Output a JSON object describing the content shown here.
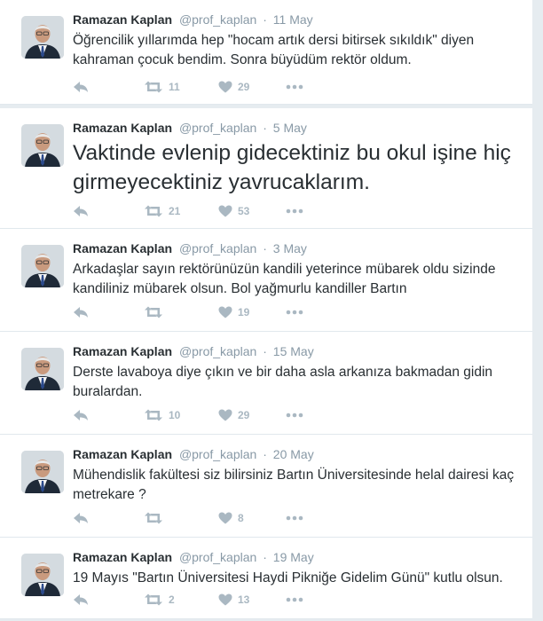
{
  "tweets": [
    {
      "fullname": "Ramazan Kaplan",
      "username": "@prof_kaplan",
      "separator": "·",
      "time": "11 May",
      "text": "Öğrencilik yıllarımda hep \"hocam artık dersi bitirsek sıkıldık\" diyen kahraman çocuk bendim. Sonra büyüdüm rektör oldum.",
      "retweets": "11",
      "likes": "29"
    },
    {
      "fullname": "Ramazan Kaplan",
      "username": "@prof_kaplan",
      "separator": "·",
      "time": "5 May",
      "text": "Vaktinde evlenip gidecektiniz bu okul işine hiç girmeyecektiniz yavrucaklarım.",
      "retweets": "21",
      "likes": "53"
    },
    {
      "fullname": "Ramazan Kaplan",
      "username": "@prof_kaplan",
      "separator": "·",
      "time": "3 May",
      "text": "Arkadaşlar sayın rektörünüzün kandili yeterince mübarek oldu sizinde kandiliniz mübarek olsun. Bol yağmurlu kandiller Bartın",
      "retweets": "",
      "likes": "19"
    },
    {
      "fullname": "Ramazan Kaplan",
      "username": "@prof_kaplan",
      "separator": "·",
      "time": "15 May",
      "text": "Derste lavaboya diye çıkın ve bir daha asla arkanıza bakmadan gidin buralardan.",
      "retweets": "10",
      "likes": "29"
    },
    {
      "fullname": "Ramazan Kaplan",
      "username": "@prof_kaplan",
      "separator": "·",
      "time": "20 May",
      "text": "Mühendislik fakültesi siz bilirsiniz Bartın Üniversitesinde helal dairesi kaç metrekare ?",
      "retweets": "",
      "likes": "8"
    },
    {
      "fullname": "Ramazan Kaplan",
      "username": "@prof_kaplan",
      "separator": "·",
      "time": "19 May",
      "text": "19 Mayıs \"Bartın Üniversitesi Haydi Pikniğe Gidelim Günü\" kutlu olsun.",
      "retweets": "2",
      "likes": "13"
    }
  ],
  "icons": {
    "reply": "reply-icon",
    "retweet": "retweet-icon",
    "like": "heart-icon",
    "more": "more-options-icon"
  },
  "colors": {
    "icon_gray": "#aab8c2",
    "meta_gray": "#8899a6",
    "text": "#292f33",
    "background": "#e6ecf0"
  }
}
